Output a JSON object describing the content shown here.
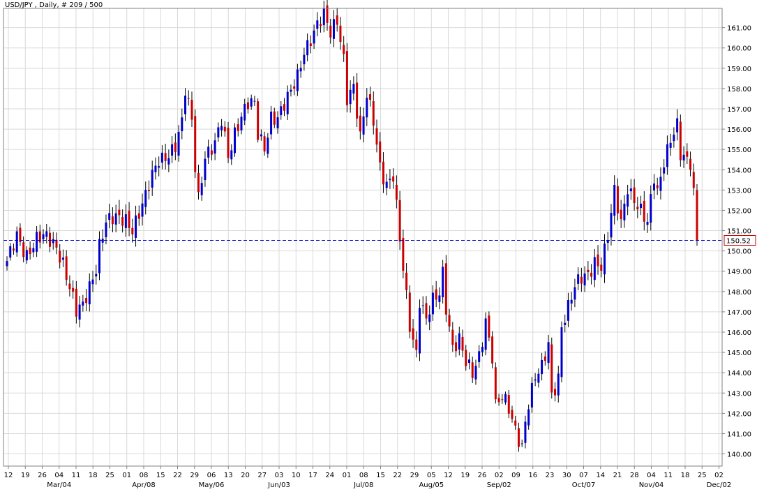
{
  "header": {
    "title": "USD/JPY , Daily, # 209 / 500"
  },
  "colors": {
    "up": "#0000cc",
    "down": "#cc0000",
    "grid": "#d9d9d9",
    "last_line": "#0000cc",
    "axis_text": "#000000"
  },
  "chart_data": {
    "type": "candlestick",
    "title": "USD/JPY , Daily, # 209 / 500",
    "ylim": [
      139.4,
      161.95
    ],
    "y_ticks": [
      140,
      141,
      142,
      143,
      144,
      145,
      146,
      147,
      148,
      149,
      150,
      151,
      152,
      153,
      154,
      155,
      156,
      157,
      158,
      159,
      160,
      161
    ],
    "y_tick_labels": [
      "140.00",
      "141.00",
      "142.00",
      "143.00",
      "144.00",
      "145.00",
      "146.00",
      "147.00",
      "148.00",
      "149.00",
      "150.00",
      "151.00",
      "152.00",
      "153.00",
      "154.00",
      "155.00",
      "156.00",
      "157.00",
      "158.00",
      "159.00",
      "160.00",
      "161.00"
    ],
    "x_tick_labels": [
      "12",
      "19",
      "26",
      "04",
      "11",
      "18",
      "25",
      "01",
      "08",
      "15",
      "22",
      "29",
      "06",
      "13",
      "20",
      "27",
      "03",
      "10",
      "17",
      "24",
      "01",
      "08",
      "15",
      "22",
      "29",
      "05",
      "12",
      "19",
      "26",
      "02",
      "09",
      "16",
      "23",
      "30",
      "07",
      "14",
      "21",
      "28",
      "04",
      "11",
      "18",
      "25",
      "02"
    ],
    "month_labels": [
      {
        "label": "Mar/04",
        "week": 3
      },
      {
        "label": "Apr/08",
        "week": 8
      },
      {
        "label": "May/06",
        "week": 12
      },
      {
        "label": "Jun/03",
        "week": 16
      },
      {
        "label": "Jul/08",
        "week": 21
      },
      {
        "label": "Aug/05",
        "week": 25
      },
      {
        "label": "Sep/02",
        "week": 29
      },
      {
        "label": "Oct/07",
        "week": 34
      },
      {
        "label": "Nov/04",
        "week": 38
      },
      {
        "label": "Dec/02",
        "week": 42
      }
    ],
    "last_value": 150.52,
    "last_label": "150.52",
    "waypoints": [
      [
        0,
        149.3
      ],
      [
        1,
        149.8
      ],
      [
        3,
        150.8
      ],
      [
        6,
        149.9
      ],
      [
        9,
        150.5
      ],
      [
        12,
        150.6
      ],
      [
        15,
        150.3
      ],
      [
        17,
        149.5
      ],
      [
        19,
        148.2
      ],
      [
        21,
        146.9
      ],
      [
        23,
        147.2
      ],
      [
        25,
        148.3
      ],
      [
        27,
        149.3
      ],
      [
        28,
        150.4
      ],
      [
        30,
        151.4
      ],
      [
        33,
        151.5
      ],
      [
        36,
        151.6
      ],
      [
        38,
        151.2
      ],
      [
        40,
        151.9
      ],
      [
        42,
        152.6
      ],
      [
        44,
        153.6
      ],
      [
        46,
        154.5
      ],
      [
        49,
        154.9
      ],
      [
        51,
        155.2
      ],
      [
        53,
        156.2
      ],
      [
        54,
        157.8
      ],
      [
        56,
        156.4
      ],
      [
        57,
        154.2
      ],
      [
        58,
        152.7
      ],
      [
        60,
        154.8
      ],
      [
        63,
        155.2
      ],
      [
        65,
        156.3
      ],
      [
        67,
        154.6
      ],
      [
        69,
        155.9
      ],
      [
        71,
        156.8
      ],
      [
        73,
        157.3
      ],
      [
        75,
        157.1
      ],
      [
        76,
        155.6
      ],
      [
        78,
        155.0
      ],
      [
        80,
        156.7
      ],
      [
        82,
        156.7
      ],
      [
        84,
        157.2
      ],
      [
        86,
        157.7
      ],
      [
        88,
        158.5
      ],
      [
        90,
        159.9
      ],
      [
        92,
        160.6
      ],
      [
        94,
        161.2
      ],
      [
        96,
        161.5
      ],
      [
        98,
        160.6
      ],
      [
        100,
        161.4
      ],
      [
        102,
        159.6
      ],
      [
        103,
        157.7
      ],
      [
        105,
        158.1
      ],
      [
        107,
        155.4
      ],
      [
        109,
        157.6
      ],
      [
        111,
        156.5
      ],
      [
        113,
        154.3
      ],
      [
        115,
        153.3
      ],
      [
        117,
        153.6
      ],
      [
        119,
        150.4
      ],
      [
        121,
        147.7
      ],
      [
        122,
        146.4
      ],
      [
        124,
        145.1
      ],
      [
        125,
        147.7
      ],
      [
        127,
        146.6
      ],
      [
        129,
        147.4
      ],
      [
        131,
        147.8
      ],
      [
        132,
        148.9
      ],
      [
        133,
        147.3
      ],
      [
        135,
        145.4
      ],
      [
        137,
        145.7
      ],
      [
        139,
        144.4
      ],
      [
        141,
        143.8
      ],
      [
        143,
        144.8
      ],
      [
        145,
        146.7
      ],
      [
        147,
        144.9
      ],
      [
        148,
        142.4
      ],
      [
        150,
        142.7
      ],
      [
        152,
        142.1
      ],
      [
        154,
        141.2
      ],
      [
        156,
        140.5
      ],
      [
        157,
        141.7
      ],
      [
        158,
        142.6
      ],
      [
        160,
        143.7
      ],
      [
        162,
        144.1
      ],
      [
        164,
        145.4
      ],
      [
        165,
        142.9
      ],
      [
        167,
        143.9
      ],
      [
        168,
        146.4
      ],
      [
        170,
        147.2
      ],
      [
        172,
        148.1
      ],
      [
        174,
        148.6
      ],
      [
        176,
        148.9
      ],
      [
        178,
        149.6
      ],
      [
        180,
        149.3
      ],
      [
        182,
        150.6
      ],
      [
        184,
        152.8
      ],
      [
        186,
        151.4
      ],
      [
        188,
        153.3
      ],
      [
        190,
        152.6
      ],
      [
        192,
        151.9
      ],
      [
        194,
        151.2
      ],
      [
        196,
        153.6
      ],
      [
        197,
        152.9
      ],
      [
        199,
        154.6
      ],
      [
        201,
        155.6
      ],
      [
        203,
        156.1
      ],
      [
        204,
        154.6
      ],
      [
        206,
        154.3
      ],
      [
        207,
        154.3
      ],
      [
        208,
        152.9
      ],
      [
        209,
        150.5
      ]
    ],
    "date_axis_label_note": ""
  }
}
